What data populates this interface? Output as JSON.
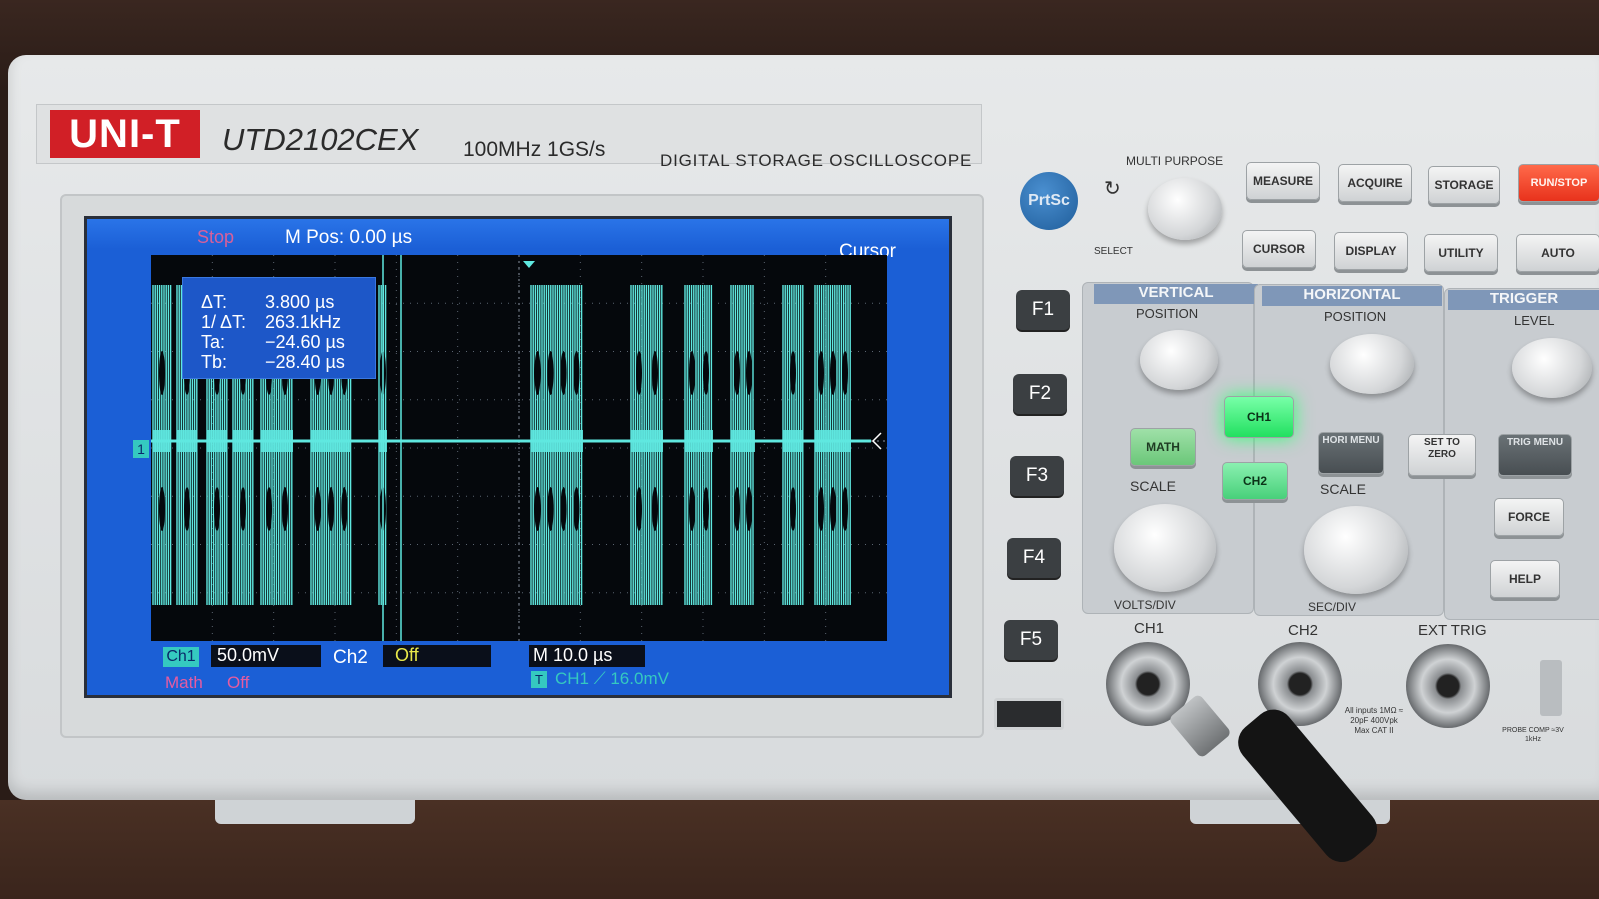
{
  "device": {
    "brand": "UNI-T",
    "model": "UTD2102CEX",
    "spec": "100MHz  1GS/s",
    "type": "DIGITAL STORAGE OSCILLOSCOPE"
  },
  "screen": {
    "status": "Stop",
    "mpos": "M Pos: 0.00 µs",
    "menu_title": "Cursor",
    "cursor_info": {
      "dt_label": "ΔT:",
      "dt_value": "3.800 µs",
      "inv_label": "1/ ΔT:",
      "inv_value": "263.1kHz",
      "ta_label": "Ta:",
      "ta_value": "−24.60 µs",
      "tb_label": "Tb:",
      "tb_value": "−28.40 µs"
    },
    "ch1_label": "Ch1",
    "ch1_scale": "50.0mV",
    "ch2_label": "Ch2",
    "ch2_state": "Off",
    "timebase": "M 10.0 µs",
    "trigger": "CH1 ⟋ 16.0mV",
    "trigger_icon": "T",
    "math_label": "Math",
    "math_state": "Off",
    "marker_ch1": "1",
    "colors": {
      "trace": "#5fe8e0",
      "screen": "#1b5fd6",
      "ch1_badge": "#35c9c0",
      "ch2_badge": "#e8e84a",
      "math": "#e65ca0"
    }
  },
  "softkeys": [
    "F1",
    "F2",
    "F3",
    "F4",
    "F5"
  ],
  "prtsc": "PrtSc",
  "panel": {
    "multi_purpose": "MULTI PURPOSE",
    "select": "SELECT",
    "top_buttons": [
      "MEASURE",
      "ACQUIRE",
      "STORAGE",
      "CURSOR",
      "DISPLAY",
      "UTILITY"
    ],
    "run_stop": "RUN/STOP",
    "auto": "AUTO",
    "vertical": "VERTICAL",
    "horizontal": "HORIZONTAL",
    "trigger": "TRIGGER",
    "position": "POSITION",
    "level": "LEVEL",
    "scale": "SCALE",
    "math": "MATH",
    "ch1": "CH1",
    "ch2": "CH2",
    "hori_menu": "HORI MENU",
    "set_to_zero": "SET TO ZERO",
    "trig_menu": "TRIG MENU",
    "force": "FORCE",
    "help": "HELP",
    "volts_div": "VOLTS/DIV",
    "sec_div": "SEC/DIV",
    "in_ch1": "CH1",
    "in_ch2": "CH2",
    "ext_trig": "EXT TRIG",
    "inputs_note": "All inputs 1MΩ ≈ 20pF 400Vpk Max CAT II",
    "probe_comp": "PROBE COMP ≈3V 1kHz"
  }
}
